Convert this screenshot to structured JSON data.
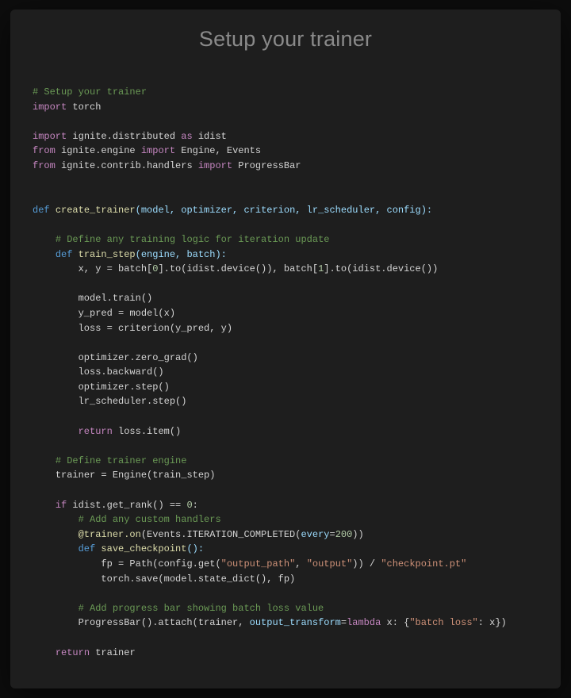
{
  "title": "Setup your trainer",
  "code": {
    "c1": "# Setup your trainer",
    "l1_kw": "import",
    "l1_mod": "torch",
    "l2_kw": "import",
    "l2_mod": "ignite.distributed",
    "l2_as": "as",
    "l2_alias": "idist",
    "l3_kw1": "from",
    "l3_mod": "ignite.engine",
    "l3_kw2": "import",
    "l3_names": "Engine, Events",
    "l4_kw1": "from",
    "l4_mod": "ignite.contrib.handlers",
    "l4_kw2": "import",
    "l4_names": "ProgressBar",
    "l5_def": "def",
    "l5_name": "create_trainer",
    "l5_params": "(model, optimizer, criterion, lr_scheduler, config):",
    "c2": "# Define any training logic for iteration update",
    "l6_def": "def",
    "l6_name": "train_step",
    "l6_params": "(engine, batch):",
    "l7": "x, y = batch[",
    "l7_n0": "0",
    "l7_c": "].to(idist.device()), batch[",
    "l7_n1": "1",
    "l7_d": "].to(idist.device())",
    "l8": "model.train()",
    "l9": "y_pred = model(x)",
    "l10": "loss = criterion(y_pred, y)",
    "l11": "optimizer.zero_grad()",
    "l12": "loss.backward()",
    "l13": "optimizer.step()",
    "l14": "lr_scheduler.step()",
    "l15_kw": "return",
    "l15_rest": " loss.item()",
    "c3": "# Define trainer engine",
    "l16": "trainer = Engine(train_step)",
    "l17_kw": "if",
    "l17_a": " idist.get_rank() == ",
    "l17_n": "0",
    "l17_b": ":",
    "c4": "# Add any custom handlers",
    "l18_dec": "@trainer.on",
    "l18_a": "(Events.ITERATION_COMPLETED(",
    "l18_kw": "every",
    "l18_eq": "=",
    "l18_n": "200",
    "l18_b": "))",
    "l19_def": "def",
    "l19_name": "save_checkpoint",
    "l19_params": "():",
    "l20_a": "fp = Path(config.get(",
    "l20_s1": "\"output_path\"",
    "l20_b": ", ",
    "l20_s2": "\"output\"",
    "l20_c": ")) / ",
    "l20_s3": "\"checkpoint.pt\"",
    "l21": "torch.save(model.state_dict(), fp)",
    "c5": "# Add progress bar showing batch loss value",
    "l22_a": "ProgressBar().attach(trainer, ",
    "l22_kw": "output_transform",
    "l22_eq": "=",
    "l22_lam": "lambda",
    "l22_b": " x: {",
    "l22_s": "\"batch loss\"",
    "l22_c": ": x})",
    "l23_kw": "return",
    "l23_rest": " trainer"
  }
}
